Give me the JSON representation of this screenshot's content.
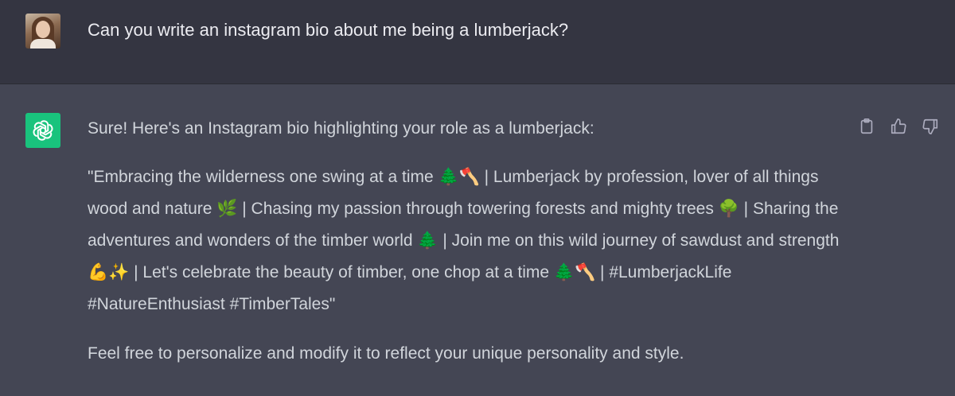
{
  "user": {
    "avatar_icon": "user-photo-avatar",
    "message": "Can you write an instagram bio about me being a lumberjack?"
  },
  "assistant": {
    "logo_icon": "openai-logo-icon",
    "intro": "Sure! Here's an Instagram bio highlighting your role as a lumberjack:",
    "bio": "\"Embracing the wilderness one swing at a time 🌲🪓 | Lumberjack by profession, lover of all things wood and nature 🌿 | Chasing my passion through towering forests and mighty trees 🌳 | Sharing the adventures and wonders of the timber world 🌲 | Join me on this wild journey of sawdust and strength 💪✨ | Let's celebrate the beauty of timber, one chop at a time 🌲🪓 | #LumberjackLife #NatureEnthusiast #TimberTales\"",
    "closing": "Feel free to personalize and modify it to reflect your unique personality and style."
  },
  "actions": [
    {
      "name": "copy",
      "icon": "clipboard-icon"
    },
    {
      "name": "thumbs-up",
      "icon": "thumbs-up-icon"
    },
    {
      "name": "thumbs-down",
      "icon": "thumbs-down-icon"
    }
  ],
  "colors": {
    "user_bg": "#343541",
    "assistant_bg": "#444654",
    "logo_bg": "#19c37d",
    "text": "#d1d5db"
  }
}
